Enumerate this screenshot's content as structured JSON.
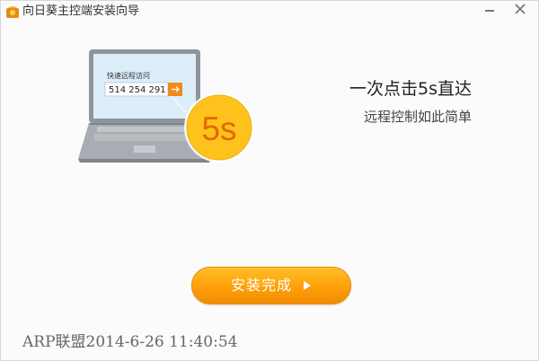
{
  "window": {
    "title": "向日葵主控端安装向导",
    "icons": {
      "app": "sunflower-app-icon",
      "minimize": "minimize-icon",
      "close": "close-icon"
    }
  },
  "hero": {
    "laptop_label": "快速远程访问",
    "laptop_code": "514 254 291",
    "badge": "5s",
    "arrow_icon": "arrow-right-icon"
  },
  "promo": {
    "headline": "一次点击5s直达",
    "subline": "远程控制如此简单"
  },
  "actions": {
    "finish_label": "安装完成",
    "finish_icon": "play-triangle-icon"
  },
  "watermark": "ARP联盟2014-6-26 11:40:54",
  "colors": {
    "accent_orange": "#ff9f0a",
    "badge_yellow": "#ffc21c",
    "laptop_gray": "#9aa0a6",
    "screen_blue": "#dceefa"
  }
}
